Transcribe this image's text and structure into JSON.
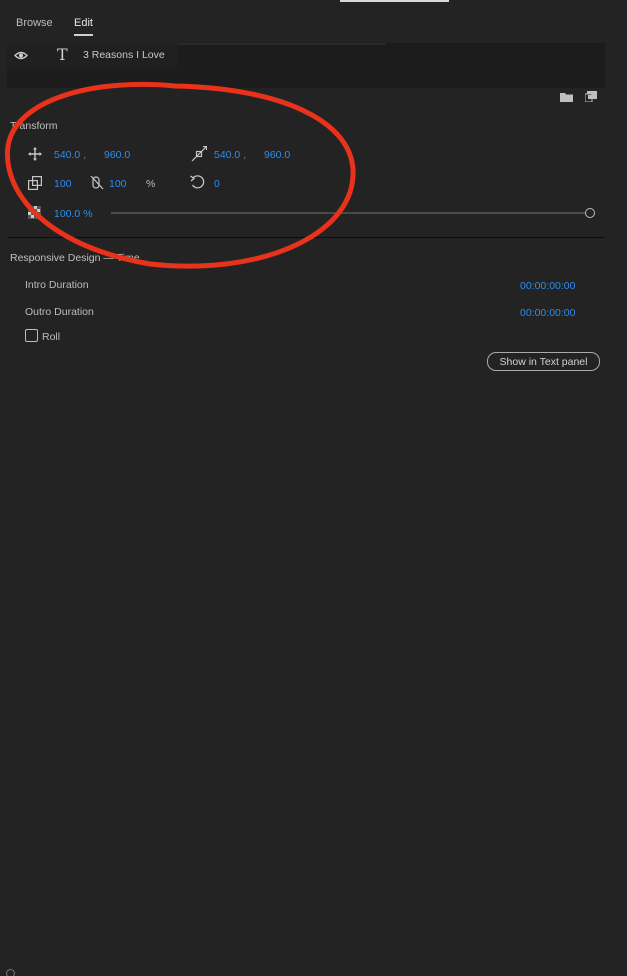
{
  "tabs": [
    {
      "label": "Browse",
      "active": false
    },
    {
      "label": "Edit",
      "active": true
    }
  ],
  "layer": {
    "name": "3 Reasons I Love",
    "eye_icon": "eye-icon",
    "type_icon": "text-T-icon"
  },
  "transform": {
    "title": "Transform",
    "position": {
      "x": "540.0 ,",
      "y": "960.0"
    },
    "anchor": {
      "x": "540.0 ,",
      "y": "960.0"
    },
    "scale": "100",
    "scale_width": "100",
    "percent": "%",
    "rotation": "0",
    "opacity": "100.0 %",
    "opacity_fraction": 1.0
  },
  "responsive": {
    "title": "Responsive Design — Time",
    "intro_label": "Intro Duration",
    "intro_value": "00:00:00:00",
    "outro_label": "Outro Duration",
    "outro_value": "00:00:00:00",
    "roll_label": "Roll"
  },
  "buttons": {
    "show_text_panel": "Show in Text panel"
  },
  "colors": {
    "background": "#232323",
    "accent_value": "#2d8ceb",
    "annotation": "#e8321b"
  }
}
